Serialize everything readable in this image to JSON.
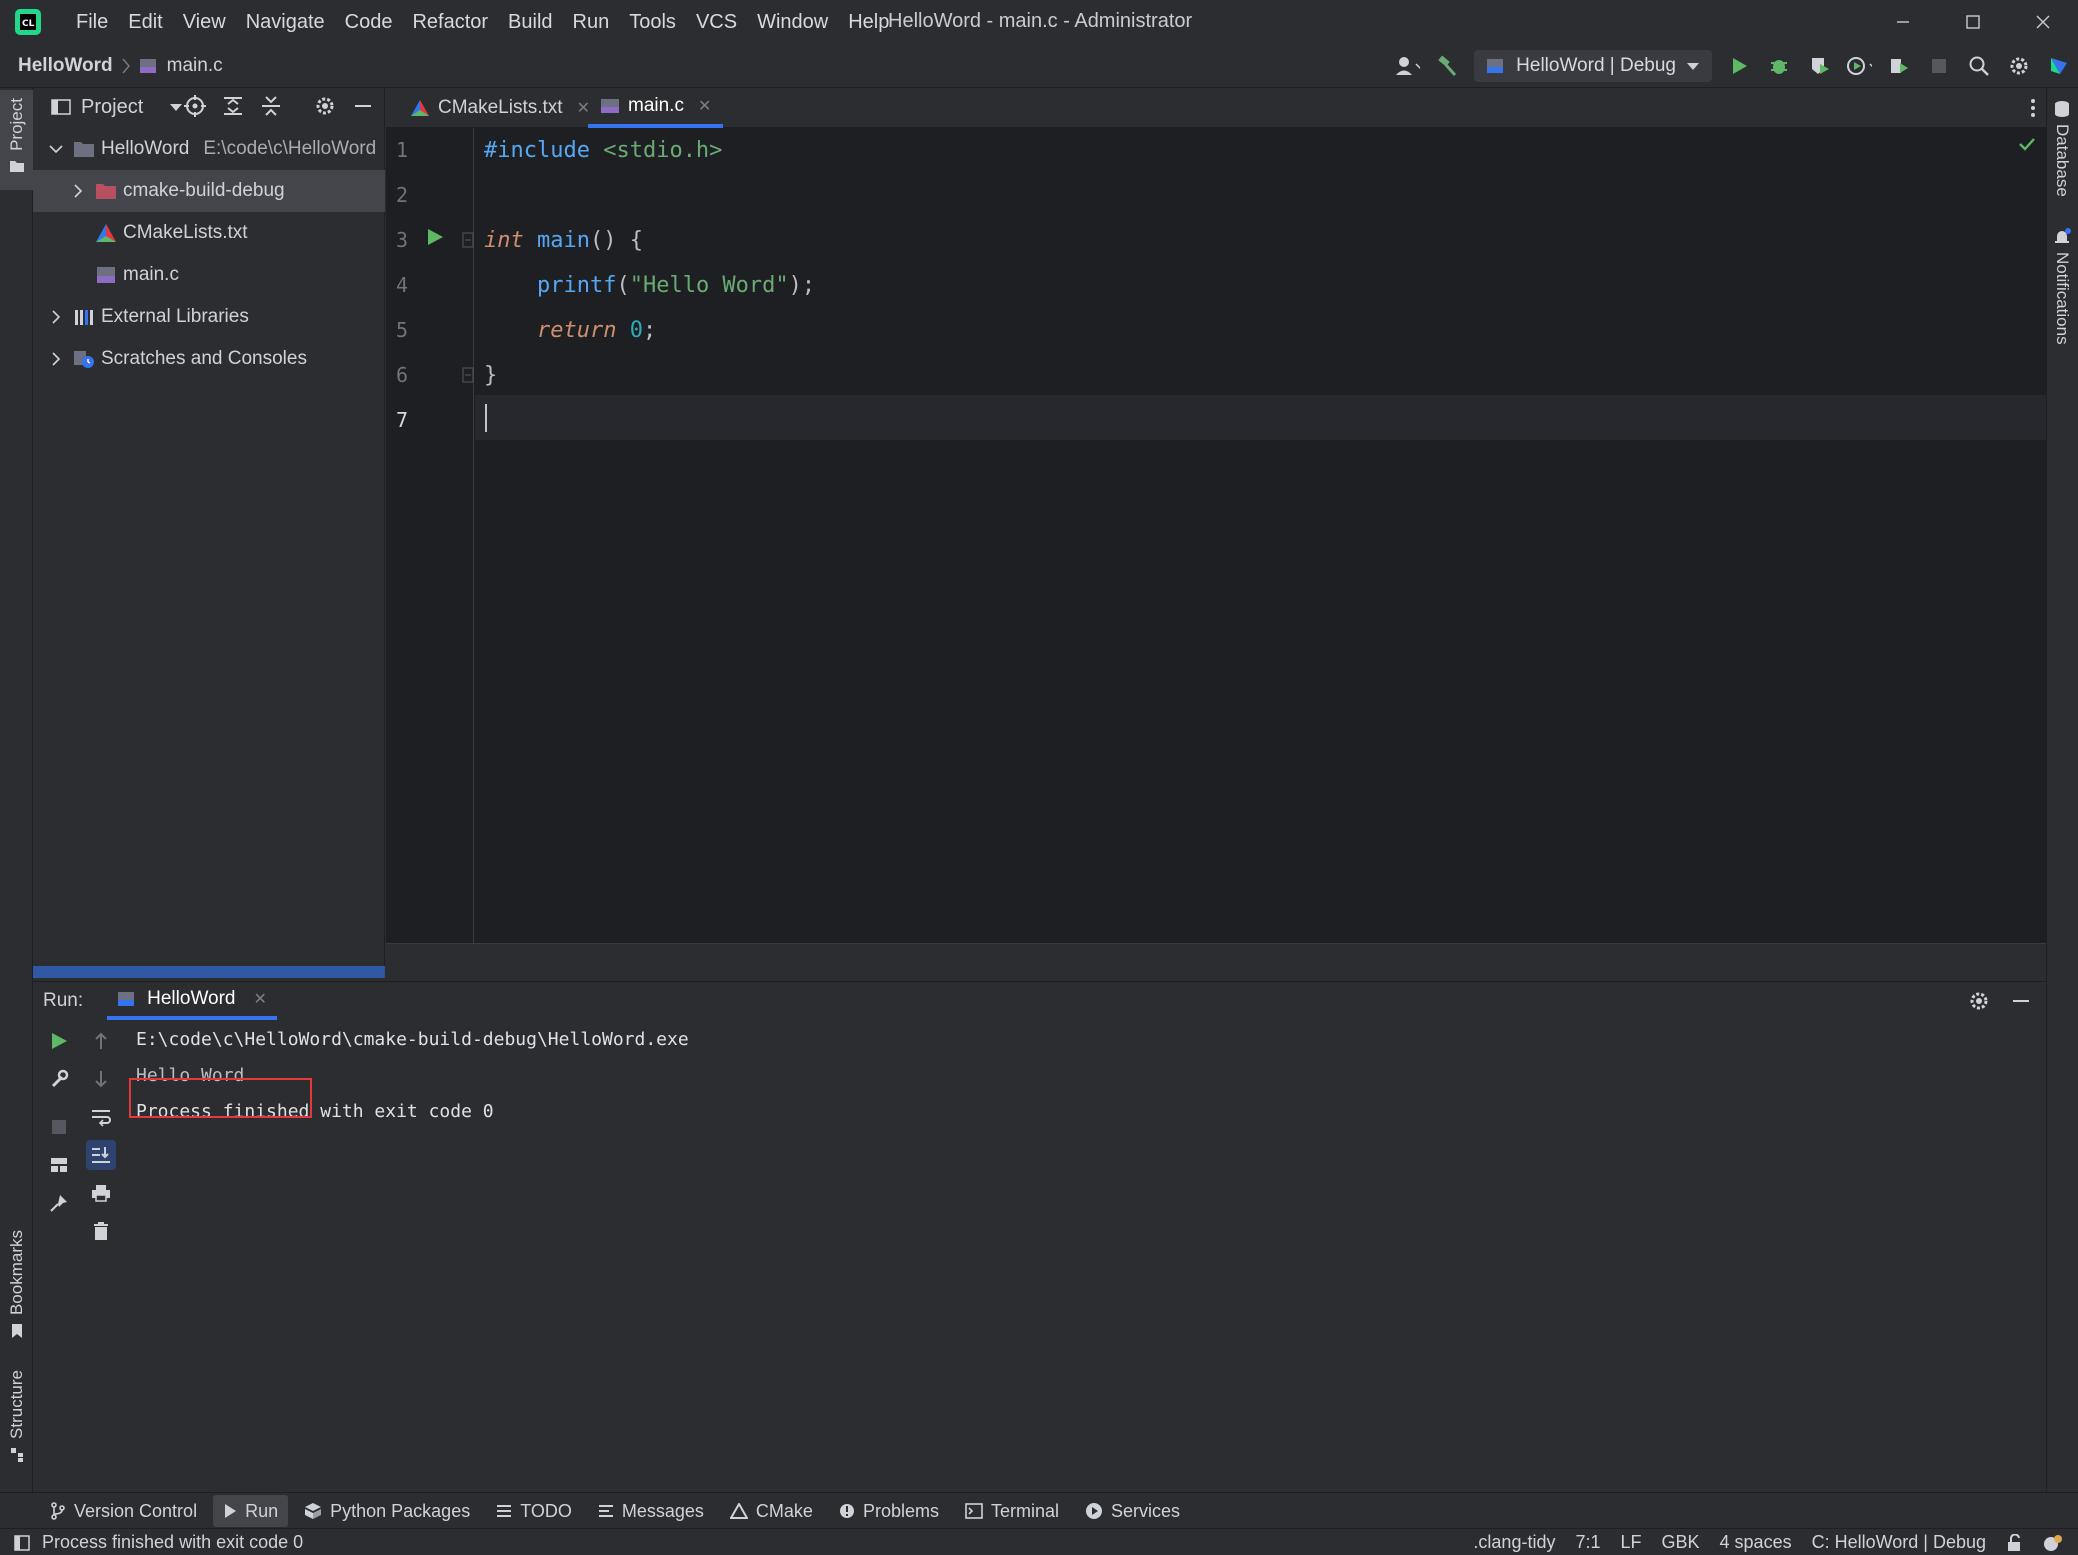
{
  "window": {
    "title": "HelloWord - main.c - Administrator"
  },
  "menu": [
    "File",
    "Edit",
    "View",
    "Navigate",
    "Code",
    "Refactor",
    "Build",
    "Run",
    "Tools",
    "VCS",
    "Window",
    "Help"
  ],
  "breadcrumb": {
    "project": "HelloWord",
    "file": "main.c"
  },
  "toolbar": {
    "run_config": "HelloWord | Debug"
  },
  "side_stripes": {
    "left_top": "Project",
    "left_bookmarks": "Bookmarks",
    "left_structure": "Structure",
    "right_database": "Database",
    "right_notifications": "Notifications"
  },
  "project_panel": {
    "title": "Project",
    "tree": [
      {
        "label": "HelloWord",
        "path": "E:\\code\\c\\HelloWord",
        "icon": "folder-icon"
      },
      {
        "label": "cmake-build-debug",
        "icon": "excluded-folder-icon"
      },
      {
        "label": "CMakeLists.txt",
        "icon": "cmake-icon"
      },
      {
        "label": "main.c",
        "icon": "c-file-icon"
      },
      {
        "label": "External Libraries",
        "icon": "library-icon"
      },
      {
        "label": "Scratches and Consoles",
        "icon": "scratches-icon"
      }
    ]
  },
  "editor": {
    "tabs": [
      {
        "label": "CMakeLists.txt",
        "active": false
      },
      {
        "label": "main.c",
        "active": true
      }
    ],
    "line_numbers": [
      "1",
      "2",
      "3",
      "4",
      "5",
      "6",
      "7"
    ],
    "code": {
      "l1_directive": "#include",
      "l1_header": "<stdio.h>",
      "l3_type": "int",
      "l3_name": "main",
      "l3_rest": "() {",
      "l4_indent": "    ",
      "l4_fn": "printf",
      "l4_open": "(",
      "l4_str": "\"Hello Word\"",
      "l4_close": ");",
      "l5_indent": "    ",
      "l5_kw": "return",
      "l5_num": "0",
      "l5_end": ";",
      "l6": "}"
    }
  },
  "run_panel": {
    "label": "Run:",
    "tab": "HelloWord",
    "console": [
      "E:\\code\\c\\HelloWord\\cmake-build-debug\\HelloWord.exe",
      "Hello Word",
      "Process finished with exit code 0"
    ]
  },
  "bottom_tools": [
    "Version Control",
    "Run",
    "Python Packages",
    "TODO",
    "Messages",
    "CMake",
    "Problems",
    "Terminal",
    "Services"
  ],
  "status": {
    "message": "Process finished with exit code 0",
    "clang_tidy": ".clang-tidy",
    "position": "7:1",
    "line_sep": "LF",
    "encoding": "GBK",
    "indent": "4 spaces",
    "context": "C: HelloWord | Debug"
  },
  "colors": {
    "accent": "#3574f0",
    "highlight_box": "#e5383b",
    "run_green": "#5fb865"
  }
}
